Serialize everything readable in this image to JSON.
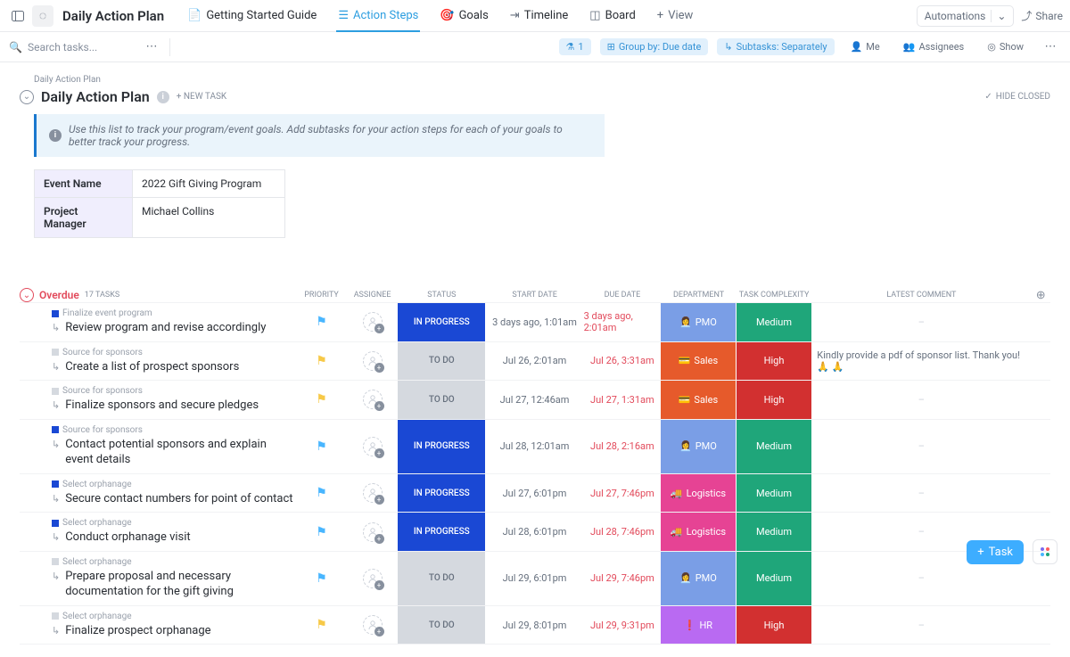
{
  "topbar": {
    "title": "Daily Action Plan",
    "tabs": [
      {
        "label": "Getting Started Guide"
      },
      {
        "label": "Action Steps",
        "active": true
      },
      {
        "label": "Goals"
      },
      {
        "label": "Timeline"
      },
      {
        "label": "Board"
      },
      {
        "label": "View",
        "add": true
      }
    ],
    "automations": "Automations",
    "share": "Share"
  },
  "filterbar": {
    "search_placeholder": "Search tasks...",
    "filter_count": "1",
    "group_by": "Group by: Due date",
    "subtasks": "Subtasks: Separately",
    "me": "Me",
    "assignees": "Assignees",
    "show": "Show"
  },
  "page": {
    "breadcrumb": "Daily Action Plan",
    "title": "Daily Action Plan",
    "new_task": "+ NEW TASK",
    "hide_closed": "HIDE CLOSED",
    "hint": "Use this list to track your program/event goals. Add subtasks for your action steps for each of your goals to better track your progress."
  },
  "meta": {
    "rows": [
      {
        "k": "Event Name",
        "v": "2022 Gift Giving Program"
      },
      {
        "k": "Project Manager",
        "v": "Michael Collins"
      }
    ]
  },
  "group": {
    "name": "Overdue",
    "count": "17 TASKS"
  },
  "columns": [
    "PRIORITY",
    "ASSIGNEE",
    "STATUS",
    "START DATE",
    "DUE DATE",
    "DEPARTMENT",
    "TASK COMPLEXITY",
    "LATEST COMMENT"
  ],
  "colors": {
    "status": {
      "in_progress": "#1a48d4",
      "to_do": "#d5d9df"
    },
    "dept": {
      "pmo": "#7a9ee6",
      "sales": "#e65a2b",
      "logistics": "#e64394",
      "hr": "#b96af2"
    },
    "complex": {
      "medium": "#1fa67a",
      "high": "#d23030"
    },
    "flag": {
      "blue": "#49b6ff",
      "yellow": "#f7c948"
    }
  },
  "tasks": [
    {
      "parent": "Finalize event program",
      "name": "Review program and revise accordingly",
      "sq": "#1a48d4",
      "flag": "blue",
      "status": "IN PROGRESS",
      "status_key": "in_progress",
      "start": "3 days ago, 1:01am",
      "due": "3 days ago, 2:01am",
      "due_over": true,
      "dept": "PMO",
      "dept_key": "pmo",
      "dept_emoji": "👩‍💼",
      "complex": "Medium",
      "complex_key": "medium",
      "comment": "–"
    },
    {
      "parent": "Source for sponsors",
      "name": "Create a list of prospect sponsors",
      "sq": "#d5d9df",
      "flag": "yellow",
      "status": "TO DO",
      "status_key": "to_do",
      "start": "Jul 26, 2:01am",
      "due": "Jul 26, 3:31am",
      "due_over": true,
      "dept": "Sales",
      "dept_key": "sales",
      "dept_emoji": "💳",
      "complex": "High",
      "complex_key": "high",
      "comment": "Kindly provide a pdf of sponsor list. Thank you! 🙏 🙏"
    },
    {
      "parent": "Source for sponsors",
      "name": "Finalize sponsors and secure pledges",
      "sq": "#d5d9df",
      "flag": "yellow",
      "status": "TO DO",
      "status_key": "to_do",
      "start": "Jul 27, 12:46am",
      "due": "Jul 27, 1:31am",
      "due_over": true,
      "dept": "Sales",
      "dept_key": "sales",
      "dept_emoji": "💳",
      "complex": "High",
      "complex_key": "high",
      "comment": "–"
    },
    {
      "parent": "Source for sponsors",
      "name": "Contact potential sponsors and explain event details",
      "sq": "#1a48d4",
      "flag": "blue",
      "status": "IN PROGRESS",
      "status_key": "in_progress",
      "start": "Jul 28, 12:01am",
      "due": "Jul 28, 2:16am",
      "due_over": true,
      "dept": "PMO",
      "dept_key": "pmo",
      "dept_emoji": "👩‍💼",
      "complex": "Medium",
      "complex_key": "medium",
      "comment": "–"
    },
    {
      "parent": "Select orphanage",
      "name": "Secure contact numbers for point of contact",
      "sq": "#1a48d4",
      "flag": "blue",
      "status": "IN PROGRESS",
      "status_key": "in_progress",
      "start": "Jul 27, 6:01pm",
      "due": "Jul 27, 7:46pm",
      "due_over": true,
      "dept": "Logistics",
      "dept_key": "logistics",
      "dept_emoji": "🚚",
      "complex": "Medium",
      "complex_key": "medium",
      "comment": "–"
    },
    {
      "parent": "Select orphanage",
      "name": "Conduct orphanage visit",
      "sq": "#1a48d4",
      "flag": "blue",
      "status": "IN PROGRESS",
      "status_key": "in_progress",
      "start": "Jul 28, 6:01pm",
      "due": "Jul 28, 7:46pm",
      "due_over": true,
      "dept": "Logistics",
      "dept_key": "logistics",
      "dept_emoji": "🚚",
      "complex": "Medium",
      "complex_key": "medium",
      "comment": "–"
    },
    {
      "parent": "Select orphanage",
      "name": "Prepare proposal and necessary documentation for the gift giving",
      "sq": "#d5d9df",
      "flag": "blue",
      "status": "TO DO",
      "status_key": "to_do",
      "start": "Jul 29, 6:01pm",
      "due": "Jul 29, 7:46pm",
      "due_over": true,
      "dept": "PMO",
      "dept_key": "pmo",
      "dept_emoji": "👩‍💼",
      "complex": "Medium",
      "complex_key": "medium",
      "comment": "–"
    },
    {
      "parent": "Select orphanage",
      "name": "Finalize prospect orphanage",
      "sq": "#d5d9df",
      "flag": "yellow",
      "status": "TO DO",
      "status_key": "to_do",
      "start": "Jul 29, 8:01pm",
      "due": "Jul 29, 9:31pm",
      "due_over": true,
      "dept": "HR",
      "dept_key": "hr",
      "dept_emoji": "❗",
      "complex": "High",
      "complex_key": "high",
      "comment": "–"
    }
  ],
  "fab": {
    "task": "Task"
  }
}
